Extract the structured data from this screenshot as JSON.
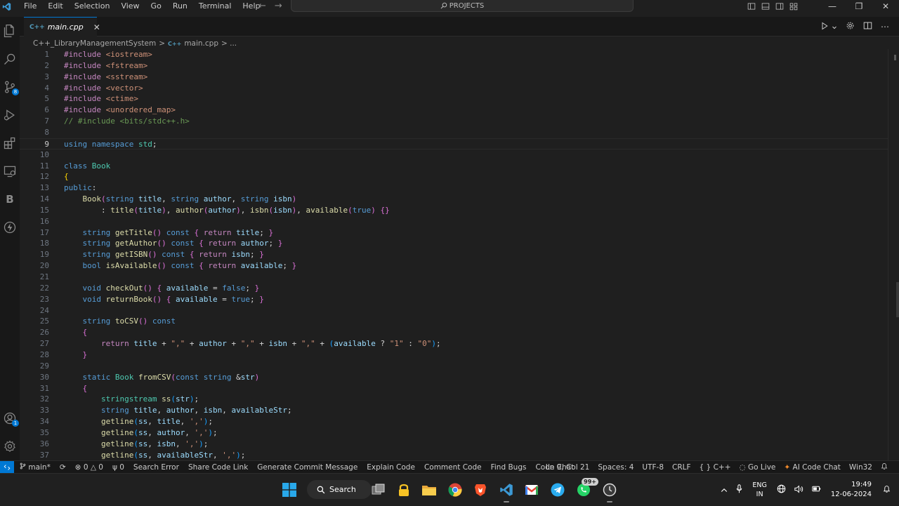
{
  "menu": [
    "File",
    "Edit",
    "Selection",
    "View",
    "Go",
    "Run",
    "Terminal",
    "Help"
  ],
  "command_center": "PROJECTS",
  "activity_badges": {
    "source_control": "8",
    "accounts": "1"
  },
  "activity_letter": "B",
  "tab": {
    "label": "main.cpp",
    "icon": "C++"
  },
  "breadcrumb": {
    "folder": "C++_LibraryManagementSystem",
    "separator": ">",
    "file": "main.cpp",
    "more": "> ..."
  },
  "editor": {
    "current_line": 9,
    "lines": [
      "#include <iostream>",
      "#include <fstream>",
      "#include <sstream>",
      "#include <vector>",
      "#include <ctime>",
      "#include <unordered_map>",
      "// #include <bits/stdc++.h>",
      "",
      "using namespace std;",
      "",
      "class Book",
      "{",
      "public:",
      "    Book(string title, string author, string isbn)",
      "        : title(title), author(author), isbn(isbn), available(true) {}",
      "",
      "    string getTitle() const { return title; }",
      "    string getAuthor() const { return author; }",
      "    string getISBN() const { return isbn; }",
      "    bool isAvailable() const { return available; }",
      "",
      "    void checkOut() { available = false; }",
      "    void returnBook() { available = true; }",
      "",
      "    string toCSV() const",
      "    {",
      "        return title + \",\" + author + \",\" + isbn + \",\" + (available ? \"1\" : \"0\");",
      "    }",
      "",
      "    static Book fromCSV(const string &str)",
      "    {",
      "        stringstream ss(str);",
      "        string title, author, isbn, availableStr;",
      "        getline(ss, title, ',');",
      "        getline(ss, author, ',');",
      "        getline(ss, isbn, ',');",
      "        getline(ss, availableStr, ',');"
    ]
  },
  "statusbar": {
    "branch": "main*",
    "errors": "0",
    "warnings": "0",
    "ports": "0",
    "left_items": [
      "Search Error",
      "Share Code Link",
      "Generate Commit Message",
      "Explain Code",
      "Comment Code",
      "Find Bugs",
      "Code Chat"
    ],
    "position": "Ln 9, Col 21",
    "spaces": "Spaces: 4",
    "encoding": "UTF-8",
    "eol": "CRLF",
    "language": "C++",
    "golive": "Go Live",
    "aichat": "AI Code Chat",
    "platform": "Win32"
  },
  "taskbar": {
    "search": "Search",
    "whatsapp_badge": "99+",
    "lang_top": "ENG",
    "lang_bottom": "IN",
    "time": "19:49",
    "date": "12-06-2024"
  },
  "colors": {
    "accent": "#0078d4",
    "background": "#1f1f1f"
  }
}
